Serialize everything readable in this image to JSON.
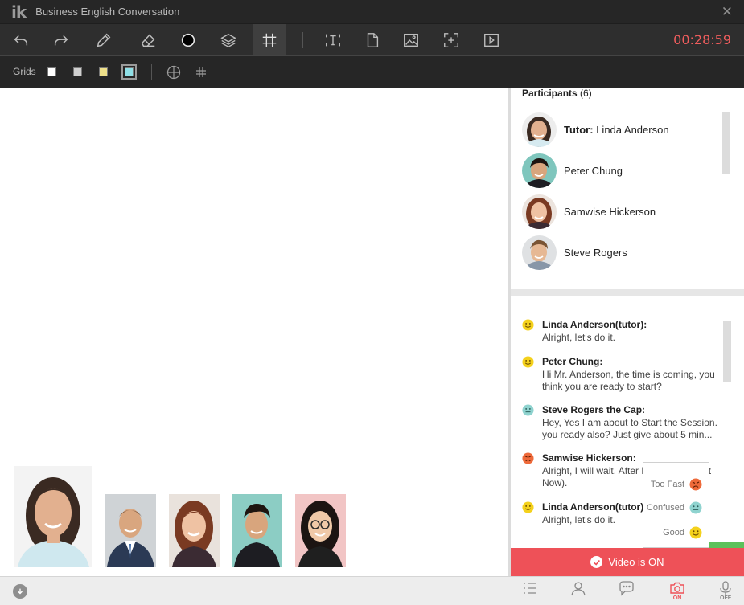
{
  "app": {
    "logo": "ik",
    "title": "Business English Conversation",
    "close": "✕"
  },
  "toolbar": {
    "tools": [
      "undo-icon",
      "redo-icon",
      "pencil-icon",
      "eraser-icon",
      "circle-color-icon",
      "layers-icon",
      "grid-icon",
      "text-icon",
      "document-icon",
      "image-icon",
      "crop-add-icon",
      "play-icon"
    ],
    "active_tool": "grid-icon",
    "timer": "00:28:59",
    "timer_color": "#f05d5d"
  },
  "grids": {
    "label": "Grids",
    "swatches": [
      "#ffffff",
      "#cfcfcf",
      "#eee08a",
      "#8fdfe6"
    ],
    "selected_swatch": "#8fdfe6"
  },
  "participants": {
    "header_label": "Participants",
    "count": "(6)",
    "list": [
      {
        "role": "Tutor:",
        "name": "Linda Anderson"
      },
      {
        "role": "",
        "name": "Peter Chung"
      },
      {
        "role": "",
        "name": "Samwise Hickerson"
      },
      {
        "role": "",
        "name": "Steve Rogers"
      }
    ]
  },
  "chat": {
    "messages": [
      {
        "mood": "good",
        "author": "Linda Anderson(tutor):",
        "text": "Alright, let's do it."
      },
      {
        "mood": "good",
        "author": "Peter Chung:",
        "text": "Hi Mr. Anderson, the time is coming, you think you are ready to start?"
      },
      {
        "mood": "confused",
        "author": "Steve Rogers the Cap:",
        "text": "Hey, Yes I am about to Start the Session. you ready also? Just give about 5 min..."
      },
      {
        "mood": "too-fast",
        "author": "Samwise Hickerson:",
        "text": "Alright, I will wait. After Button (Connect Now)."
      },
      {
        "mood": "good",
        "author": "Linda Anderson(tutor)",
        "text": "Alright, let's do it."
      }
    ]
  },
  "feedback": {
    "options": [
      {
        "label": "Too Fast",
        "mood": "too-fast"
      },
      {
        "label": "Confused",
        "mood": "confused"
      },
      {
        "label": "Good",
        "mood": "good"
      }
    ]
  },
  "mood_colors": {
    "good": "#f4d11c",
    "confused": "#8fd3cf",
    "too-fast": "#ee6a3a"
  },
  "video": {
    "label": "Video is ON",
    "color": "#ee5158"
  },
  "bottombar": {
    "icons": [
      "list-icon",
      "person-icon",
      "chat-icon",
      "camera-icon",
      "microphone-icon"
    ],
    "camera_state": "ON",
    "mic_state": "OFF"
  }
}
